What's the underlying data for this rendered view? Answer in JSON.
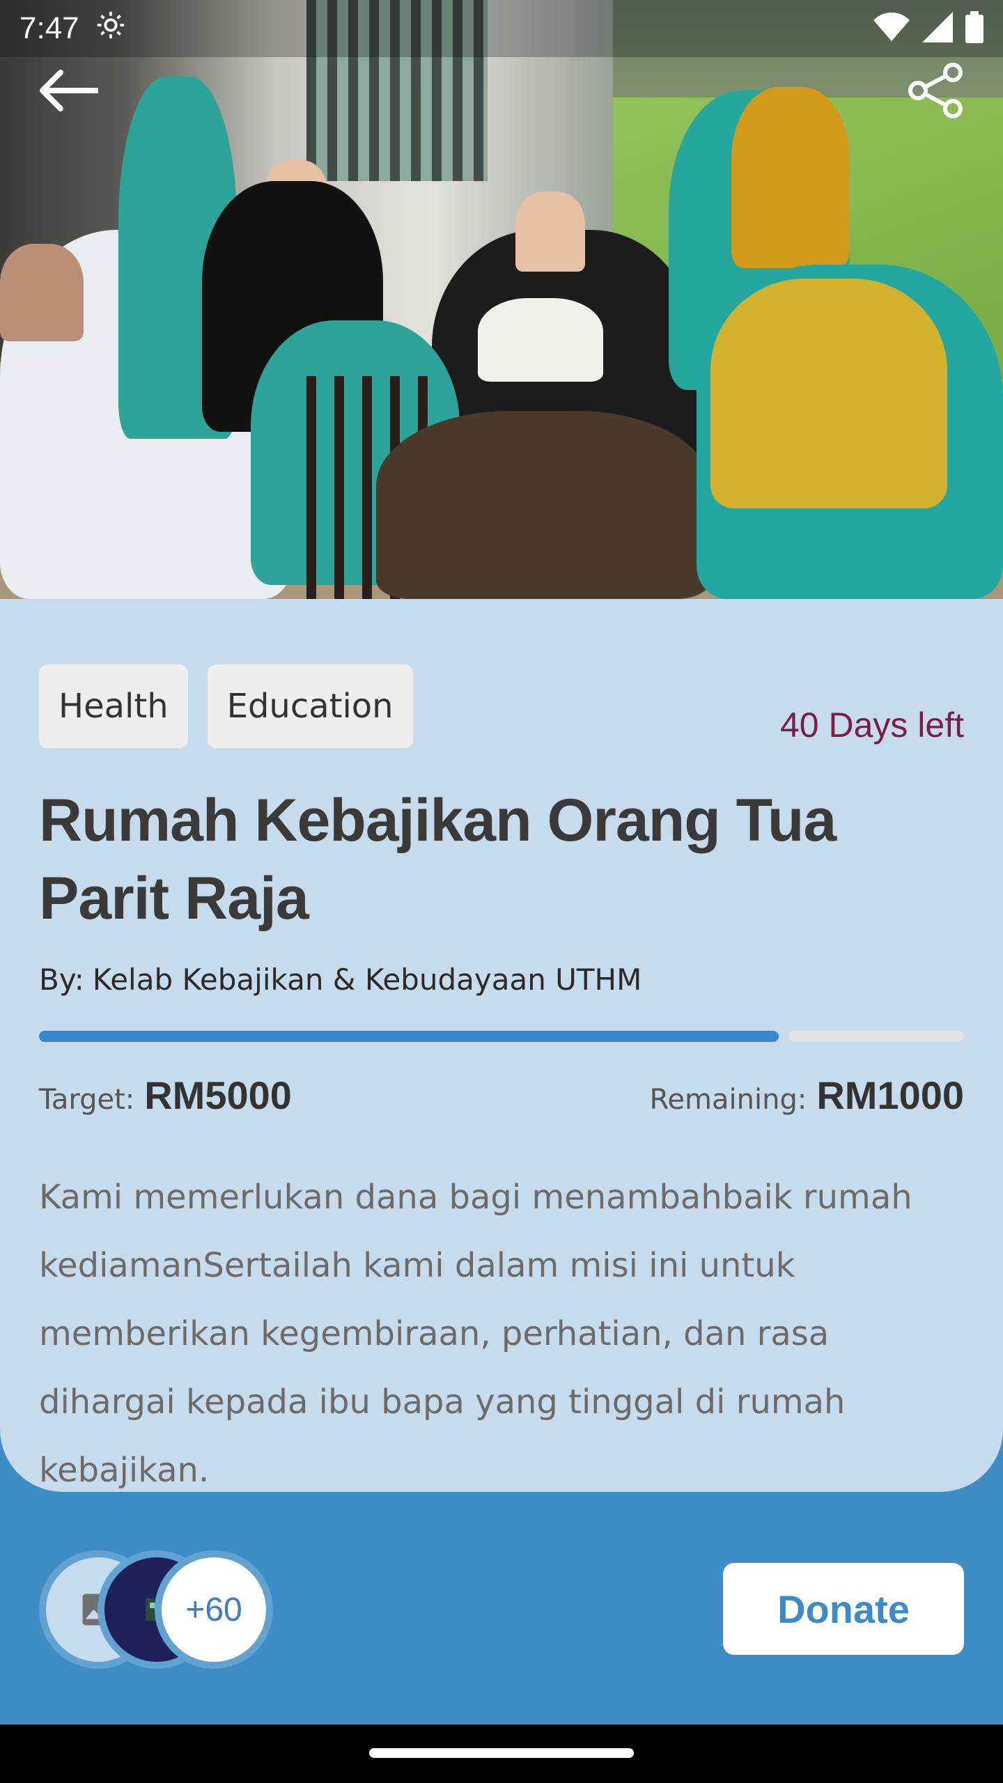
{
  "status_bar": {
    "time": "7:47"
  },
  "campaign": {
    "tags": [
      "Health",
      "Education"
    ],
    "days_left": "40 Days left",
    "title": "Rumah Kebajikan Orang Tua Parit Raja",
    "by_label": "By:",
    "organizer": "Kelab Kebajikan & Kebudayaan UTHM",
    "progress_fraction": 0.8,
    "target_label": "Target:",
    "target_amount": "RM5000",
    "remaining_label": "Remaining:",
    "remaining_amount": "RM1000",
    "description": "Kami memerlukan dana bagi menambahbaik rumah kediamanSertailah kami dalam misi ini untuk memberikan kegembiraan, perhatian, dan rasa dihargai kepada ibu bapa yang tinggal di rumah kebajikan."
  },
  "donors": {
    "more_count": "+60"
  },
  "actions": {
    "donate_label": "Donate"
  },
  "colors": {
    "accent": "#3d8ac8",
    "days_left": "#7a1d4a",
    "card_bg": "#c6dcec",
    "page_bg": "#3f8dc6"
  },
  "icons": [
    "back-arrow-icon",
    "share-icon",
    "settings-gear-icon",
    "wifi-icon",
    "signal-icon",
    "battery-icon",
    "image-placeholder-icon"
  ]
}
